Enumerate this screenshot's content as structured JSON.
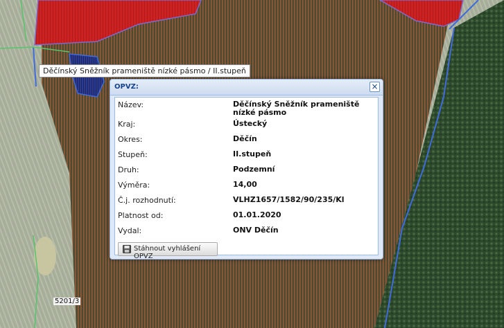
{
  "tooltip": {
    "text": "Děčínský Sněžník prameniště nízké pásmo / II.stupeň"
  },
  "parcel_label": "5201/3",
  "popup": {
    "title": "OPVZ:",
    "close_symbol": "×",
    "rows": [
      {
        "label": "Název:",
        "value": "Děčínský Sněžník prameniště nízké pásmo"
      },
      {
        "label": "Kraj:",
        "value": "Ústecký"
      },
      {
        "label": "Okres:",
        "value": "Děčín"
      },
      {
        "label": "Stupeň:",
        "value": "II.stupeň"
      },
      {
        "label": "Druh:",
        "value": "Podzemní"
      },
      {
        "label": "Výměra:",
        "value": "14,00"
      },
      {
        "label": "Č.j. rozhodnutí:",
        "value": "VLHZ1657/1582/90/235/Kl"
      },
      {
        "label": "Platnost od:",
        "value": "01.01.2020"
      },
      {
        "label": "Vydal:",
        "value": "ONV Děčín"
      }
    ],
    "download_button": {
      "label": "Stáhnout vyhlášení OPVZ",
      "icon": "floppy-disk-icon"
    }
  },
  "colors": {
    "protection_zone_red": "#d02020",
    "boundary_blue": "#3f6bdc",
    "boundary_green": "#57c46b",
    "hatch_brown": "#b25c3a"
  }
}
